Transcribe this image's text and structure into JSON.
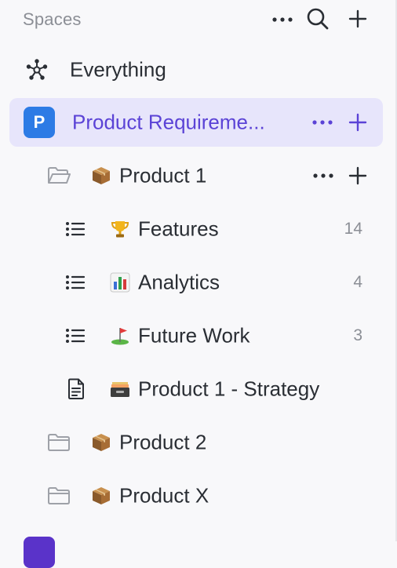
{
  "header": {
    "title": "Spaces",
    "icons": [
      "more-icon",
      "search-icon",
      "plus-icon"
    ]
  },
  "nav": {
    "everything": {
      "label": "Everything",
      "icon": "everything-hub-icon"
    }
  },
  "space": {
    "avatar_letter": "P",
    "label": "Product Requireme...",
    "color": "#2d7be5",
    "accent": "#5b43d6",
    "highlight": "#e7e5fb"
  },
  "tree": {
    "product1": {
      "label": "Product 1",
      "icon": "folder-open-icon",
      "emoji": "package"
    },
    "lists": [
      {
        "label": "Features",
        "emoji": "trophy",
        "count": "14"
      },
      {
        "label": "Analytics",
        "emoji": "bar-chart",
        "count": "4"
      },
      {
        "label": "Future Work",
        "emoji": "golf-flag",
        "count": "3"
      }
    ],
    "doc": {
      "label": "Product 1 - Strategy",
      "emoji": "card-file-box"
    },
    "product2": {
      "label": "Product 2",
      "icon": "folder-icon",
      "emoji": "package"
    },
    "productx": {
      "label": "Product X",
      "icon": "folder-icon",
      "emoji": "package"
    }
  }
}
